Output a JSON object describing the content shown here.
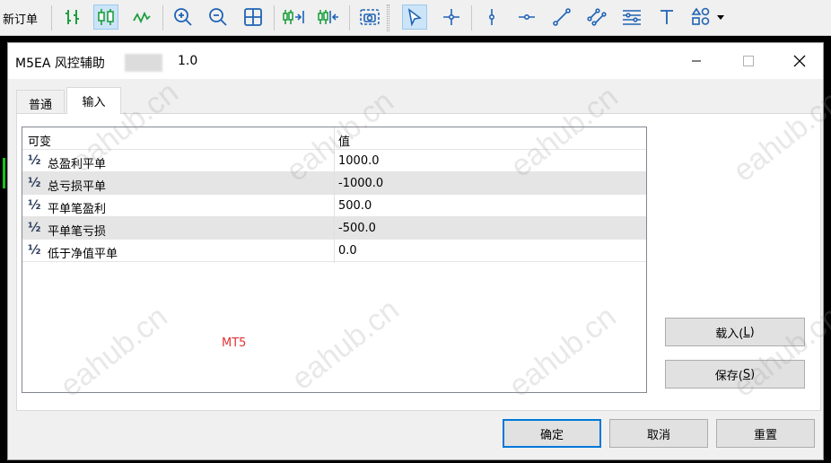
{
  "toolbar": {
    "new_order_label": "新订单",
    "icons": [
      "bar-chart-icon",
      "candlestick-icon",
      "line-chart-icon",
      "zoom-in-icon",
      "zoom-out-icon",
      "tile-windows-icon",
      "chart-shift-icon",
      "autoscroll-icon",
      "screenshot-icon",
      "cursor-icon",
      "crosshair-icon",
      "vertical-line-icon",
      "horizontal-line-icon",
      "trendline-icon",
      "channel-icon",
      "fibonacci-icon",
      "text-icon",
      "shapes-icon",
      "dropdown-icon"
    ]
  },
  "dialog": {
    "title": "M5EA 风控辅助",
    "version": "1.0",
    "tabs": [
      {
        "label": "普通"
      },
      {
        "label": "输入"
      }
    ],
    "active_tab": "输入",
    "grid": {
      "headers": {
        "variable": "可变",
        "value": "值"
      },
      "type_glyph": "½",
      "rows": [
        {
          "name": "总盈利平单",
          "value": "1000.0"
        },
        {
          "name": "总亏损平单",
          "value": "-1000.0"
        },
        {
          "name": "平单笔盈利",
          "value": "500.0"
        },
        {
          "name": "平单笔亏损",
          "value": "-500.0"
        },
        {
          "name": "低于净值平单",
          "value": "0.0"
        }
      ],
      "overlay_text": "MT5"
    },
    "side_buttons": {
      "load": {
        "text": "载入(",
        "key": "L",
        "close": ")"
      },
      "save": {
        "text": "保存(",
        "key": "S",
        "close": ")"
      }
    },
    "bottom_buttons": {
      "ok": "确定",
      "cancel": "取消",
      "reset": "重置"
    }
  },
  "watermark": "eahub.cn",
  "colors": {
    "accent": "#0078d7",
    "mt5_label": "#e13434",
    "alt_row": "#e5e5e5",
    "chart_bg": "#000000",
    "chart_green": "#19c219"
  }
}
